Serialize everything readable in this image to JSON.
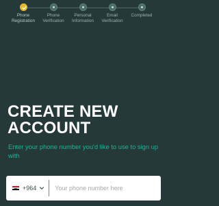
{
  "colors": {
    "background": "#253938",
    "accent": "#1bb49a",
    "completed_step": "#e7b82a",
    "title": "#ffffff"
  },
  "steps": [
    {
      "label_line1": "Phone",
      "label_line2": "Registration",
      "state": "completed",
      "icon": "check-icon"
    },
    {
      "label_line1": "Phone",
      "label_line2": "Verification",
      "state": "pending"
    },
    {
      "label_line1": "Personal",
      "label_line2": "Information",
      "state": "pending"
    },
    {
      "label_line1": "Email",
      "label_line2": "Verification",
      "state": "pending"
    },
    {
      "label_line1": "Completed",
      "label_line2": "",
      "state": "pending"
    }
  ],
  "heading": {
    "line1": "CREATE NEW",
    "line2": "ACCOUNT"
  },
  "subtitle": "Enter your phone number you'd like to use to sign up with",
  "phone": {
    "country_flag": "iraq-flag",
    "country_code": "+964",
    "placeholder": "Your phone number here",
    "value": ""
  }
}
